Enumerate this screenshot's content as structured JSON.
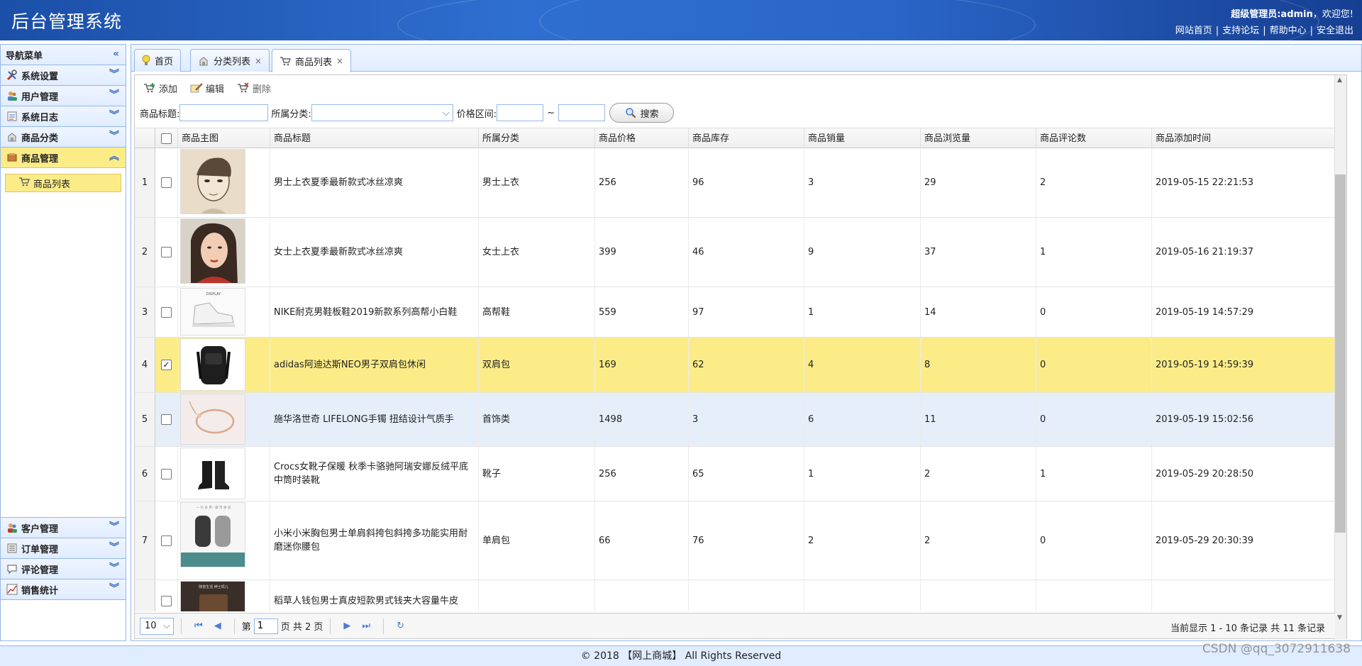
{
  "header": {
    "title": "后台管理系统",
    "welcome_prefix": "超级管理员:admin",
    "welcome_suffix": "，欢迎您!",
    "links": [
      "网站首页",
      "支持论坛",
      "帮助中心",
      "安全退出"
    ]
  },
  "sidebar": {
    "title": "导航菜单",
    "groups_top": [
      {
        "label": "系统设置",
        "icon": "tools-icon"
      },
      {
        "label": "用户管理",
        "icon": "users-icon"
      },
      {
        "label": "系统日志",
        "icon": "log-icon"
      },
      {
        "label": "商品分类",
        "icon": "category-icon"
      },
      {
        "label": "商品管理",
        "icon": "goods-icon",
        "active": true
      }
    ],
    "active_item": "商品列表",
    "groups_bottom": [
      {
        "label": "客户管理",
        "icon": "customer-icon"
      },
      {
        "label": "订单管理",
        "icon": "order-icon"
      },
      {
        "label": "评论管理",
        "icon": "comment-icon"
      },
      {
        "label": "销售统计",
        "icon": "chart-icon"
      }
    ]
  },
  "tabs": [
    {
      "label": "首页",
      "icon": "lightbulb-icon",
      "closable": false
    },
    {
      "label": "分类列表",
      "icon": "category-icon",
      "closable": true
    },
    {
      "label": "商品列表",
      "icon": "cart-icon",
      "closable": true,
      "selected": true
    }
  ],
  "toolbar": {
    "add_label": "添加",
    "edit_label": "编辑",
    "delete_label": "删除"
  },
  "search": {
    "title_label": "商品标题:",
    "category_label": "所属分类:",
    "price_label": "价格区间:",
    "range_sep": "~",
    "button_label": "搜索"
  },
  "grid": {
    "columns": [
      "商品主图",
      "商品标题",
      "所属分类",
      "商品价格",
      "商品库存",
      "商品销量",
      "商品浏览量",
      "商品评论数",
      "商品添加时间"
    ],
    "rows": [
      {
        "n": "1",
        "title": "男士上衣夏季最新款式冰丝凉爽",
        "category": "男士上衣",
        "price": "256",
        "stock": "96",
        "sales": "3",
        "views": "29",
        "comments": "2",
        "time": "2019-05-15 22:21:53",
        "image": "sketch-portrait-image"
      },
      {
        "n": "2",
        "title": "女士上衣夏季最新款式冰丝凉爽",
        "category": "女士上衣",
        "price": "399",
        "stock": "46",
        "sales": "9",
        "views": "37",
        "comments": "1",
        "time": "2019-05-16 21:19:37",
        "image": "woman-portrait-image"
      },
      {
        "n": "3",
        "title": "NIKE耐克男鞋板鞋2019新款系列高帮小白鞋",
        "category": "高帮鞋",
        "price": "559",
        "stock": "97",
        "sales": "1",
        "views": "14",
        "comments": "0",
        "time": "2019-05-19 14:57:29",
        "image": "white-sneaker-image"
      },
      {
        "n": "4",
        "title": "adidas阿迪达斯NEO男子双肩包休闲",
        "category": "双肩包",
        "price": "169",
        "stock": "62",
        "sales": "4",
        "views": "8",
        "comments": "0",
        "time": "2019-05-19 14:59:39",
        "image": "black-backpack-image",
        "checked": true
      },
      {
        "n": "5",
        "title": "施华洛世奇 LIFELONG手镯 扭结设计气质手",
        "category": "首饰类",
        "price": "1498",
        "stock": "3",
        "sales": "6",
        "views": "11",
        "comments": "0",
        "time": "2019-05-19 15:02:56",
        "image": "bracelet-image"
      },
      {
        "n": "6",
        "title": "Crocs女靴子保暖 秋季卡骆驰阿瑞安娜反绒平底中筒时装靴",
        "category": "靴子",
        "price": "256",
        "stock": "65",
        "sales": "1",
        "views": "2",
        "comments": "1",
        "time": "2019-05-29 20:28:50",
        "image": "black-boots-image"
      },
      {
        "n": "7",
        "title": "小米小米胸包男士单肩斜挎包斜挎多功能实用耐磨迷你腰包",
        "category": "单肩包",
        "price": "66",
        "stock": "76",
        "sales": "2",
        "views": "2",
        "comments": "0",
        "time": "2019-05-29 20:30:39",
        "image": "chest-bag-image"
      },
      {
        "n": "",
        "title": "稻草人钱包男士真皮短款男式钱夹大容量牛皮",
        "category": "",
        "price": "",
        "stock": "",
        "sales": "",
        "views": "",
        "comments": "",
        "time": "",
        "image": "wallet-image"
      }
    ]
  },
  "pager": {
    "page_size": "10",
    "page_prefix": "第",
    "page_value": "1",
    "page_suffix": "页 共 2 页",
    "info": "当前显示 1 - 10 条记录 共 11 条记录"
  },
  "footer": {
    "text": "© 2018 【网上商城】 All Rights Reserved"
  },
  "watermark": "CSDN @qq_3072911638",
  "colors": {
    "header_blue": "#2a66c8",
    "selected_row": "#fbec88",
    "hover_row": "#e6eef9",
    "border_blue": "#95b8e7"
  }
}
